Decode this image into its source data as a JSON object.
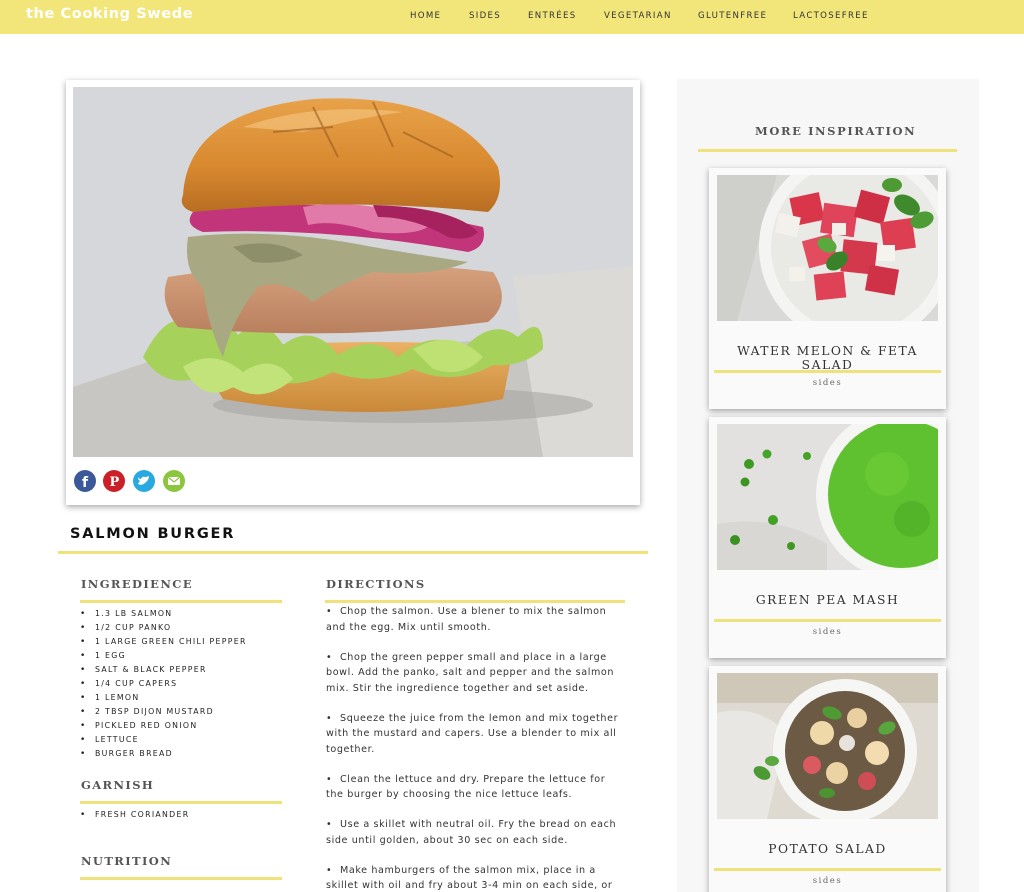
{
  "header": {
    "brand": "the Cooking Swede",
    "nav": [
      "HOME",
      "SIDES",
      "ENTRÉES",
      "VEGETARIAN",
      "GLUTENFREE",
      "LACTOSEFREE"
    ]
  },
  "recipe": {
    "title": "SALMON BURGER",
    "share_icons": [
      "facebook-icon",
      "pinterest-icon",
      "twitter-icon",
      "email-icon"
    ],
    "ingredients_heading": "INGREDIENCE",
    "ingredients": [
      "1.3 lb salmon",
      "1/2 cup panko",
      "1 large green chili pepper",
      "1 egg",
      "salt & black pepper",
      "1/4 cup capers",
      "1 lemon",
      "2 tbsp dijon mustard",
      "pickled red onion",
      "lettuce",
      "burger bread"
    ],
    "garnish_heading": "GARNISH",
    "garnish": [
      "fresh coriander"
    ],
    "nutrition_heading": "NUTRITION",
    "directions_heading": "DIRECTIONS",
    "directions": [
      "Chop the salmon. Use a blener to mix the salmon and the egg. Mix until smooth.",
      "Chop the green pepper small and place in a large bowl. Add the panko, salt and pepper and the salmon mix. Stir the ingredience together and set aside.",
      "Squeeze the juice from the lemon and mix together with the mustard and capers. Use a blender to mix all together.",
      "Clean the lettuce and dry. Prepare the lettuce for the burger by choosing the nice lettuce leafs.",
      "Use a skillet with neutral oil. Fry the bread on each side until golden, about 30 sec on each side.",
      "Make hamburgers of the salmon mix, place in a skillet with oil and fry about 3-4 min on each side, or"
    ]
  },
  "sidebar": {
    "heading": "MORE INSPIRATION",
    "items": [
      {
        "name": "WATER MELON & FETA SALAD",
        "category": "sides"
      },
      {
        "name": "GREEN PEA MASH",
        "category": "sides"
      },
      {
        "name": "POTATO SALAD",
        "category": "sides"
      }
    ]
  },
  "colors": {
    "accent_yellow": "#f2e67a",
    "rule_yellow": "#f0e27a",
    "facebook": "#3b5998",
    "pinterest": "#cb2027",
    "twitter": "#2aa9e0",
    "email": "#8cc63f"
  }
}
